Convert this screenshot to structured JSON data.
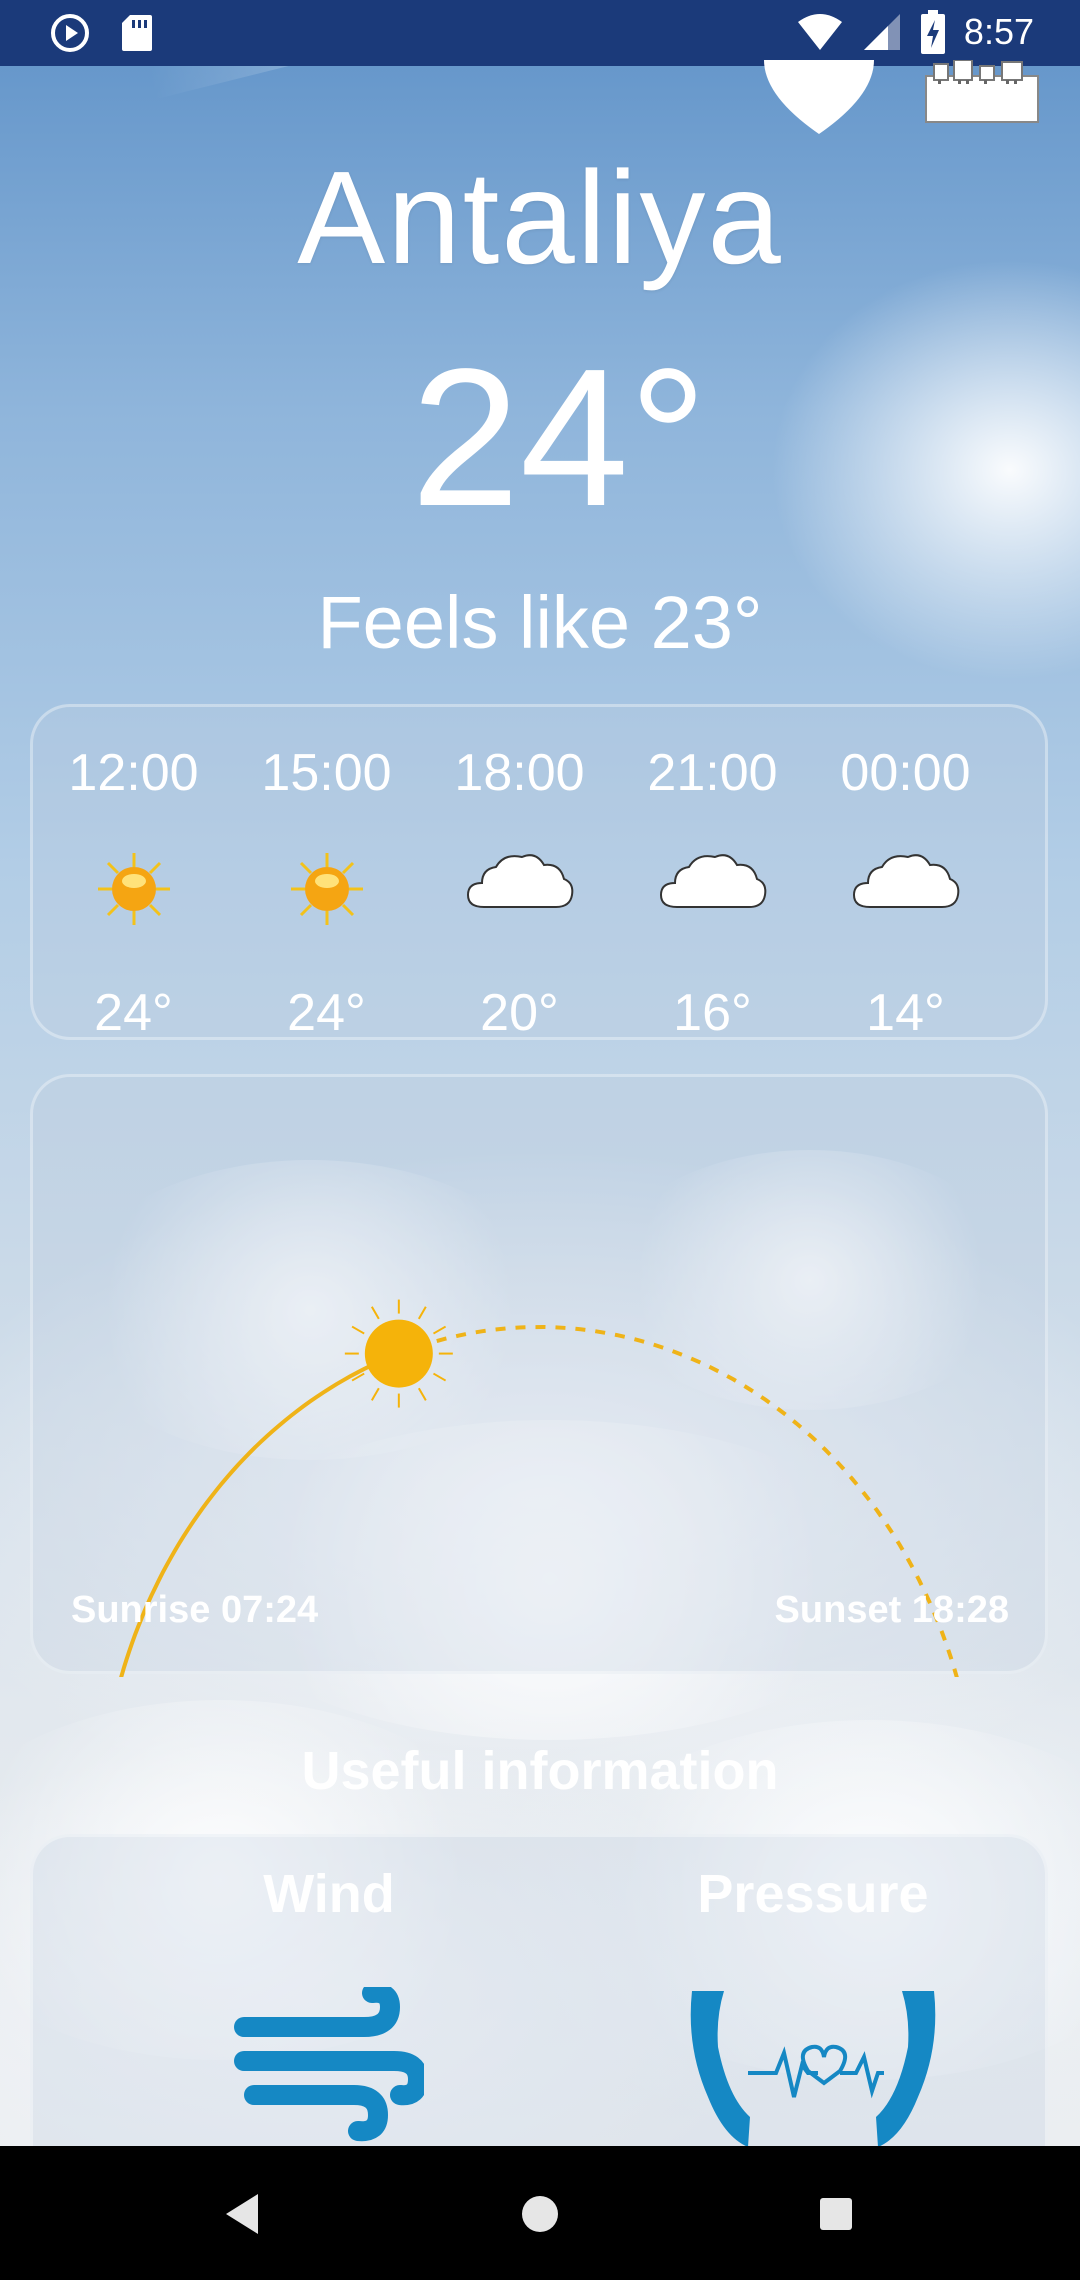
{
  "status_bar": {
    "time": "8:57",
    "left_icons": [
      "play-icon",
      "sd-card-icon"
    ],
    "right_icons": [
      "wifi-icon",
      "cell-signal-icon",
      "battery-charging-icon"
    ]
  },
  "header": {
    "favorite_icon": "heart-icon",
    "city_icon": "city-skyline-icon"
  },
  "current": {
    "city": "Antaliya",
    "temperature": "24°",
    "feels_like": "Feels like 23°"
  },
  "hourly": [
    {
      "time": "12:00",
      "icon": "sun-icon",
      "temp": "24°"
    },
    {
      "time": "15:00",
      "icon": "sun-icon",
      "temp": "24°"
    },
    {
      "time": "18:00",
      "icon": "cloud-icon",
      "temp": "20°"
    },
    {
      "time": "21:00",
      "icon": "cloud-icon",
      "temp": "16°"
    },
    {
      "time": "00:00",
      "icon": "cloud-icon",
      "temp": "14°"
    }
  ],
  "sun": {
    "sunrise": "Sunrise 07:24",
    "sunset": "Sunset 18:28",
    "day_progress": 0.38,
    "arc_color": "#efb318"
  },
  "useful": {
    "title": "Useful information",
    "items": [
      {
        "label": "Wind",
        "icon": "wind-icon"
      },
      {
        "label": "Pressure",
        "icon": "pressure-hands-heart-icon"
      }
    ]
  },
  "nav_bar": {
    "buttons": [
      "back-icon",
      "home-icon",
      "recents-icon"
    ]
  },
  "colors": {
    "status_bar": "#1b3a7a",
    "sun": "#f5b30a",
    "icon_blue": "#1588c4"
  }
}
